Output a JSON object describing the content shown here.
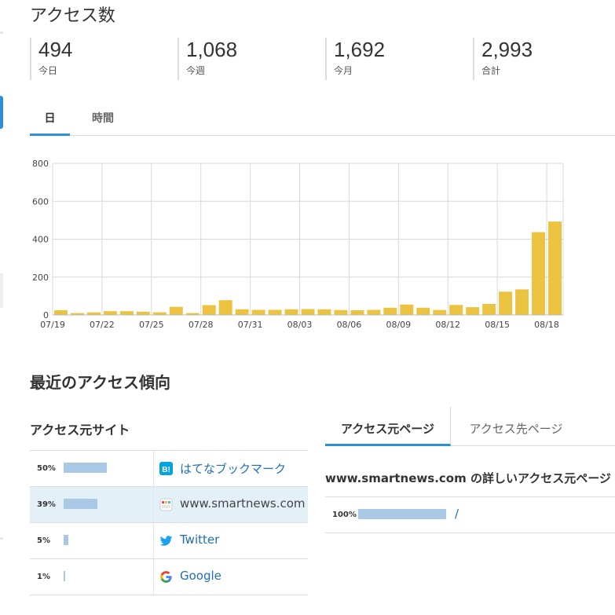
{
  "page_title": "アクセス数",
  "stats": [
    {
      "value": "494",
      "label": "今日"
    },
    {
      "value": "1,068",
      "label": "今週"
    },
    {
      "value": "1,692",
      "label": "今月"
    },
    {
      "value": "2,993",
      "label": "合計"
    }
  ],
  "tabs": {
    "day": "日",
    "hour": "時間",
    "active": "day"
  },
  "colors": {
    "accent": "#2d8fd8",
    "bar": "#ecc340",
    "source_bar": "#a9c8e6",
    "link": "#1f6fb2"
  },
  "chart_data": {
    "type": "bar",
    "categories": [
      "07/19",
      "07/20",
      "07/21",
      "07/22",
      "07/23",
      "07/24",
      "07/25",
      "07/26",
      "07/27",
      "07/28",
      "07/29",
      "07/30",
      "07/31",
      "08/01",
      "08/02",
      "08/03",
      "08/04",
      "08/05",
      "08/06",
      "08/07",
      "08/08",
      "08/09",
      "08/10",
      "08/11",
      "08/12",
      "08/13",
      "08/14",
      "08/15",
      "08/16",
      "08/17",
      "08/18"
    ],
    "values": [
      25,
      10,
      14,
      20,
      20,
      17,
      14,
      43,
      10,
      52,
      78,
      30,
      27,
      27,
      30,
      31,
      30,
      26,
      25,
      27,
      38,
      55,
      38,
      26,
      53,
      41,
      58,
      123,
      135,
      437,
      493
    ],
    "tick_labels": [
      "07/19",
      "07/22",
      "07/25",
      "07/28",
      "07/31",
      "08/03",
      "08/06",
      "08/09",
      "08/12",
      "08/15",
      "08/18"
    ],
    "ylim": [
      0,
      800
    ],
    "yticks": [
      0,
      200,
      400,
      600,
      800
    ],
    "grid": true
  },
  "trend_title": "最近のアクセス傾向",
  "sources": {
    "title": "アクセス元サイト",
    "rows": [
      {
        "percent": "50%",
        "share": 0.5,
        "name": "はてなブックマーク",
        "icon": "hatena-icon",
        "linked": true,
        "highlight": false
      },
      {
        "percent": "39%",
        "share": 0.39,
        "name": "www.smartnews.com",
        "icon": "smartnews-icon",
        "linked": false,
        "highlight": true
      },
      {
        "percent": "5%",
        "share": 0.05,
        "name": "Twitter",
        "icon": "twitter-icon",
        "linked": true,
        "highlight": false
      },
      {
        "percent": "1%",
        "share": 0.01,
        "name": "Google",
        "icon": "google-icon",
        "linked": true,
        "highlight": false
      }
    ]
  },
  "page_tabs": {
    "inbound": "アクセス元ページ",
    "outbound": "アクセス先ページ",
    "active": "inbound"
  },
  "detail": {
    "title": "www.smartnews.com の詳しいアクセス元ページ",
    "rows": [
      {
        "percent": "100%",
        "share": 1.0,
        "path": "/"
      }
    ]
  }
}
